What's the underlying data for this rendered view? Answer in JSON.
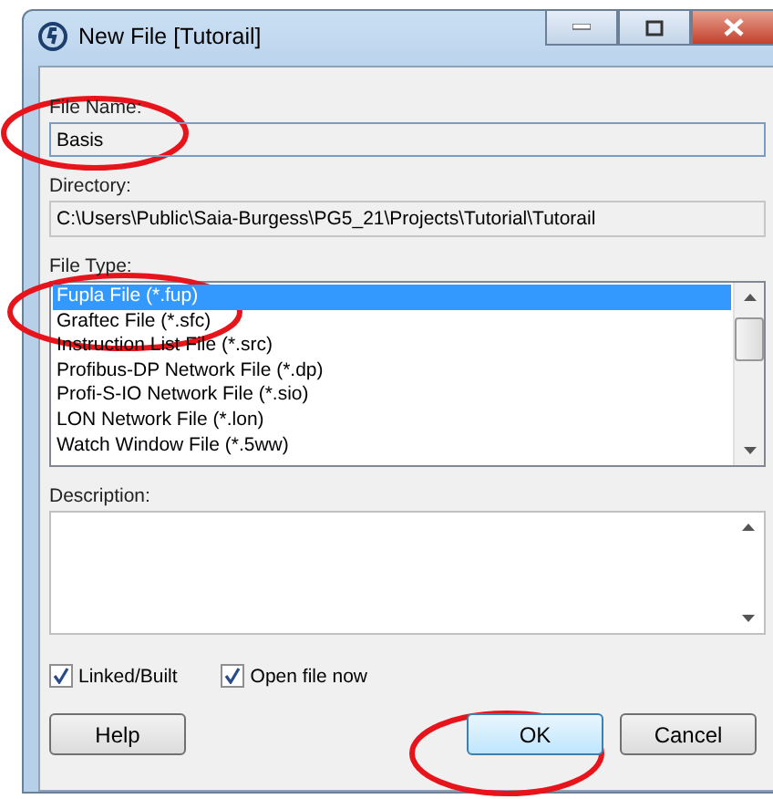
{
  "window": {
    "title": "New File [Tutorail]"
  },
  "file_name": {
    "label": "File Name:",
    "value": "Basis"
  },
  "directory": {
    "label": "Directory:",
    "value": "C:\\Users\\Public\\Saia-Burgess\\PG5_21\\Projects\\Tutorial\\Tutorail"
  },
  "file_type": {
    "label": "File Type:",
    "items": [
      {
        "label": "Fupla File (*.fup)",
        "selected": true
      },
      {
        "label": "Graftec File (*.sfc)",
        "selected": false
      },
      {
        "label": "Instruction List File (*.src)",
        "selected": false
      },
      {
        "label": "Profibus-DP Network File (*.dp)",
        "selected": false
      },
      {
        "label": "Profi-S-IO Network File (*.sio)",
        "selected": false
      },
      {
        "label": "LON Network File (*.lon)",
        "selected": false
      },
      {
        "label": "Watch Window File (*.5ww)",
        "selected": false
      }
    ]
  },
  "description": {
    "label": "Description:"
  },
  "options": [
    {
      "label": "Linked/Built",
      "checked": true
    },
    {
      "label": "Open file now",
      "checked": true
    }
  ],
  "buttons": [
    {
      "label": "Help",
      "kind": "normal"
    },
    {
      "label": "OK",
      "kind": "default"
    },
    {
      "label": "Cancel",
      "kind": "normal"
    }
  ]
}
